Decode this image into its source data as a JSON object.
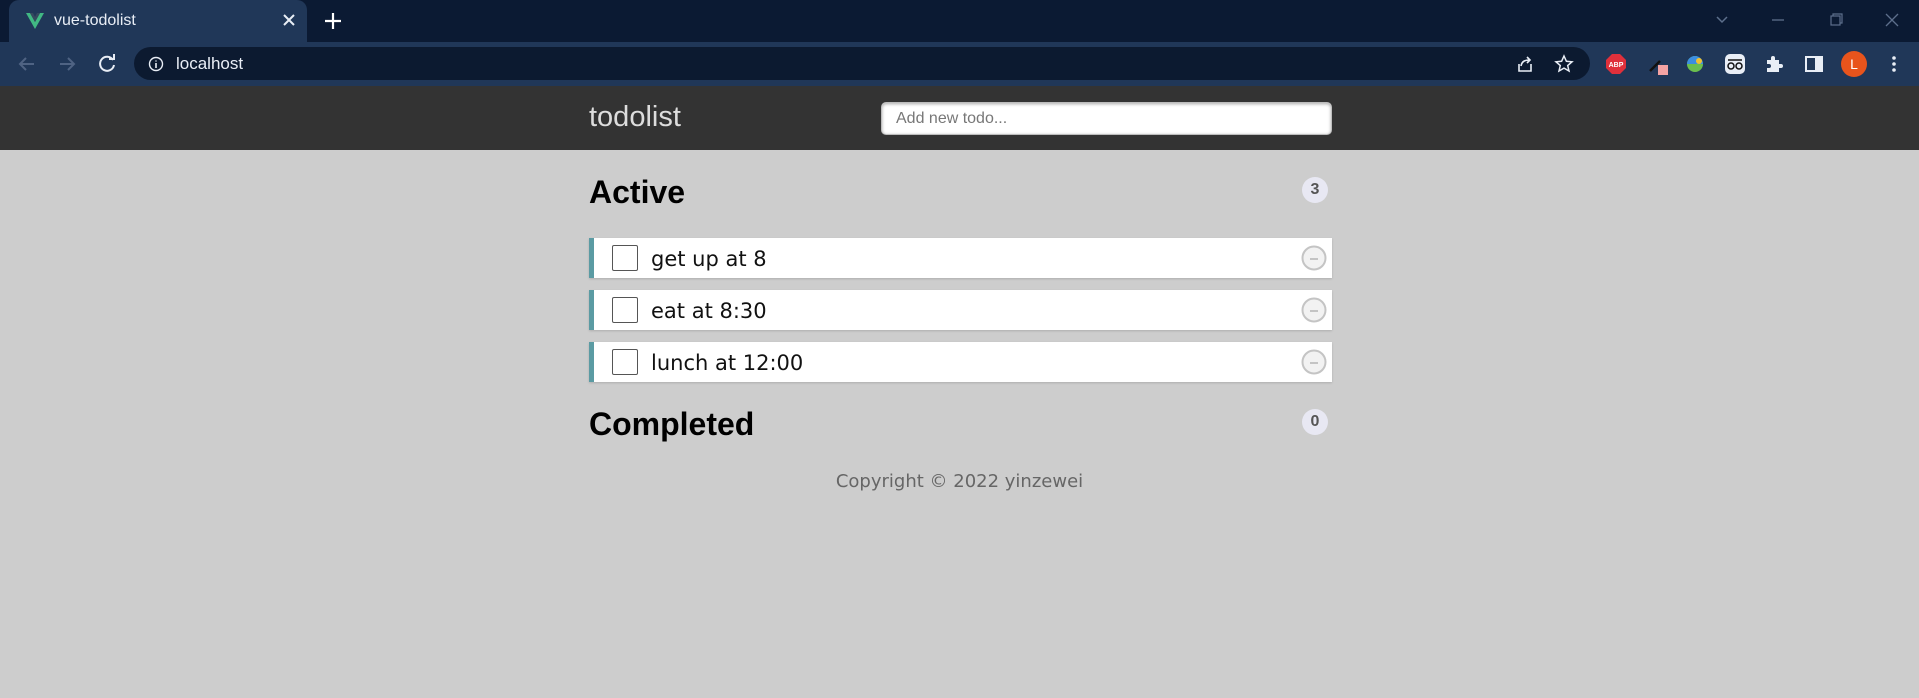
{
  "browser": {
    "tab": {
      "title": "vue-todolist",
      "favicon": "vue-logo-icon"
    },
    "address": {
      "url": "localhost"
    },
    "extensions": [
      "adblock-plus-icon",
      "eyedropper-icon",
      "colorful-extension-icon",
      "glasses-icon",
      "puzzle-icon",
      "side-panel-icon"
    ],
    "profile_initial": "L",
    "colors": {
      "tabstrip": "#0b1a33",
      "toolbar": "#203758",
      "avatar": "#e8541c"
    }
  },
  "app": {
    "title": "todolist",
    "new_todo": {
      "placeholder": "Add new todo...",
      "value": ""
    },
    "active": {
      "title": "Active",
      "count": "3",
      "items": [
        {
          "text": "get up at 8",
          "done": false
        },
        {
          "text": "eat at 8:30",
          "done": false
        },
        {
          "text": "lunch at 12:00",
          "done": false
        }
      ]
    },
    "completed": {
      "title": "Completed",
      "count": "0",
      "items": []
    },
    "footer": "Copyright © 2022 yinzewei",
    "colors": {
      "header": "#333333",
      "background": "#cdcdcd",
      "accent": "#5b9ba3"
    }
  }
}
